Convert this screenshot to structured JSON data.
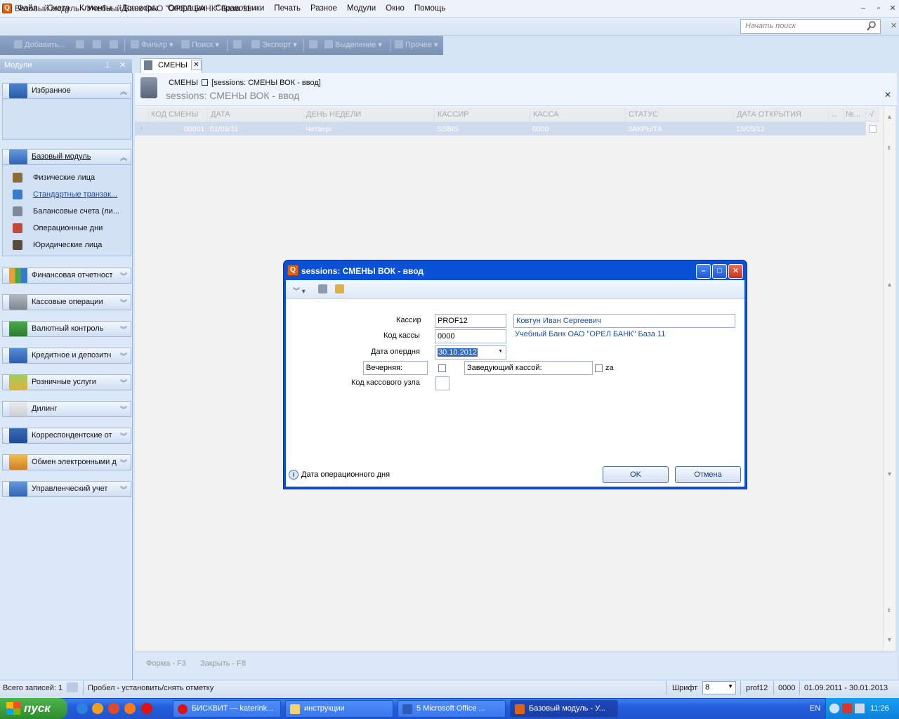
{
  "window": {
    "title": "Базовый модуль - Учебный Банк ОАО \"ОРЕЛ БАНК\" База 11 -",
    "app_icon_letter": "Q"
  },
  "menu": [
    "Файл",
    "Счета",
    "Клиенты",
    "Договоры",
    "Операции",
    "Справочники",
    "Печать",
    "Разное",
    "Модули",
    "Окно",
    "Помощь"
  ],
  "search": {
    "placeholder": "Начать поиск"
  },
  "toolbar": {
    "add": "Добавить...",
    "filter": "Фильтр",
    "search": "Поиск",
    "export": "Экспорт",
    "select": "Выделение",
    "other": "Прочее"
  },
  "left_panel": {
    "title": "Модули",
    "favorites": "Избранное",
    "base_module": "Базовый модуль",
    "base_items": [
      "Физические лица",
      "Стандартные транзак...",
      "Балансовые счета (ли...",
      "Операционные дни",
      "Юридические лица"
    ],
    "groups": [
      "Финансовая отчетност",
      "Кассовые операции",
      "Валютный контроль",
      "Кредитное и депозитн",
      "Розничные услуги",
      "Дилинг",
      "Корреспондентские от",
      "Обмен электронными д",
      "Управленческий учет"
    ]
  },
  "tab": {
    "label": "СМЕНЫ"
  },
  "doc": {
    "crumb_main": "СМЕНЫ",
    "crumb_sub": "[sessions: СМЕНЫ ВОК - ввод]",
    "title": "sessions: СМЕНЫ ВОК - ввод"
  },
  "grid": {
    "columns": [
      "КОД СМЕНЫ",
      "ДАТА",
      "ДЕНЬ НЕДЕЛИ",
      "КАССИР",
      "КАССА",
      "СТАТУС",
      "ДАТА ОТКРЫТИЯ",
      "...",
      "№...",
      "√"
    ],
    "row": [
      "00001",
      "01/09/11",
      "Четверг",
      "SSBIS",
      "0000",
      "ЗАКРЫТА",
      "15/05/12"
    ]
  },
  "form_keys": {
    "form": "Форма - F3",
    "close": "Закрыть - F8"
  },
  "status": {
    "records": "Всего записей: 1",
    "hint": "Пробел - установить/снять отметку",
    "font_label": "Шрифт",
    "font_value": "8",
    "user": "prof12",
    "cash": "0000",
    "period": "01.09.2011 - 30.01.2013"
  },
  "taskbar": {
    "start": "пуск",
    "tasks": [
      "БИСКВИТ — katerink...",
      "инструкции",
      "5 Microsoft Office ...",
      "Базовый модуль - У..."
    ],
    "lang": "EN",
    "clock": "11:26"
  },
  "dialog": {
    "title": "sessions: СМЕНЫ ВОК - ввод",
    "cashier_label": "Кассир",
    "cashier_code": "PROF12",
    "cashier_name": "Ковтун Иван Сергеевич",
    "cash_label": "Код кассы",
    "cash_code": "0000",
    "cash_bank": "Учебный Банк ОАО \"ОРЕЛ БАНК\" База 11",
    "date_label": "Дата опердня",
    "date_value": "30.10.2012",
    "evening_label": "Вечерняя:",
    "manager_label": "Заведующий кассой:",
    "manager_suffix": "za",
    "node_label": "Код кассового узла",
    "hint": "Дата операционного дня",
    "ok": "OK",
    "cancel": "Отмена"
  }
}
